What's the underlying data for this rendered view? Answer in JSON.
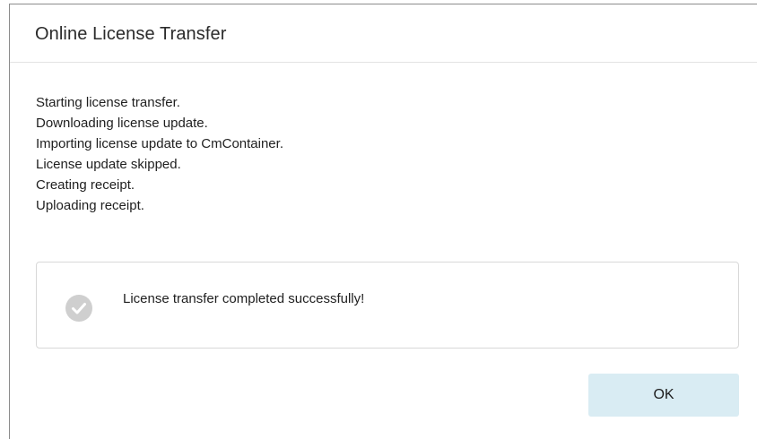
{
  "dialog": {
    "title": "Online License Transfer",
    "log_lines": [
      "Starting license transfer.",
      "Downloading license update.",
      "Importing license update to CmContainer.",
      "License update skipped.",
      "Creating receipt.",
      "Uploading receipt."
    ],
    "result": {
      "icon": "check-circle-icon",
      "message": "License transfer completed successfully!"
    },
    "ok_label": "OK"
  },
  "colors": {
    "ok_button_bg": "#d9ecf3",
    "check_icon_fill": "#cfcfcf",
    "border": "#d8d8d8"
  }
}
